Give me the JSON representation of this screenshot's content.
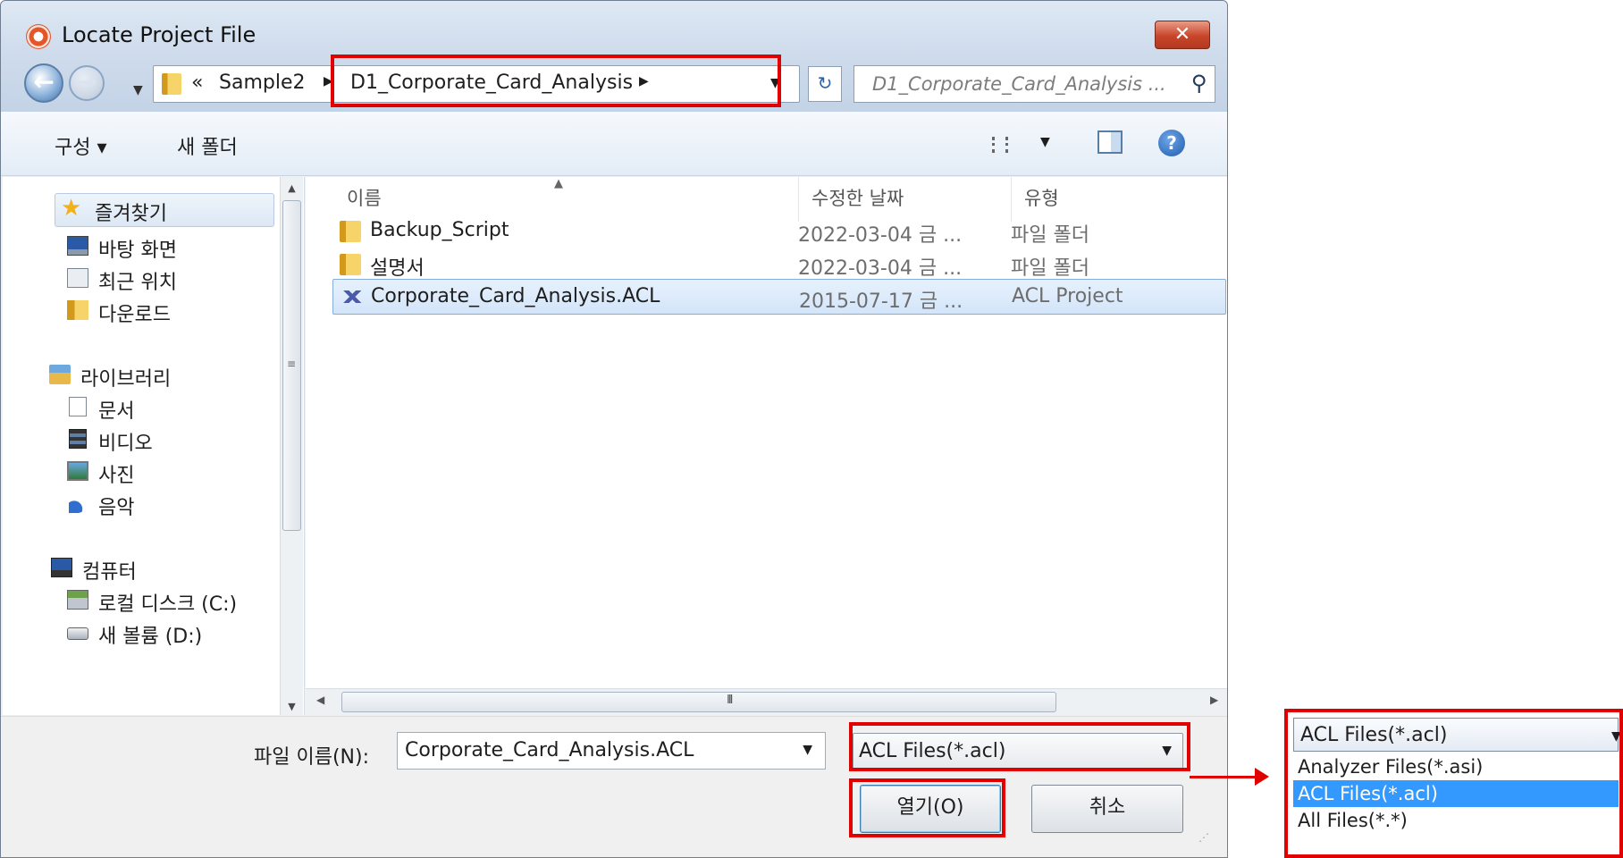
{
  "window": {
    "title": "Locate Project File",
    "close_label": "✕"
  },
  "nav": {
    "back_glyph": "←",
    "forward_glyph": "→"
  },
  "address_bar": {
    "overflow": "«",
    "crumbs": [
      "Sample2",
      "D1_Corporate_Card_Analysis"
    ]
  },
  "search": {
    "placeholder": "D1_Corporate_Card_Analysis ..."
  },
  "toolbar": {
    "organize": "구성 ▾",
    "new_folder": "새 폴더",
    "help": "?"
  },
  "sidebar": {
    "favorites": "즐겨찾기",
    "items": [
      {
        "label": "바탕 화면",
        "icon": "desktop-icon"
      },
      {
        "label": "최근 위치",
        "icon": "recent-places-icon"
      },
      {
        "label": "다운로드",
        "icon": "downloads-icon"
      }
    ],
    "libraries": "라이브러리",
    "library_items": [
      {
        "label": "문서",
        "icon": "documents-icon"
      },
      {
        "label": "비디오",
        "icon": "videos-icon"
      },
      {
        "label": "사진",
        "icon": "pictures-icon"
      },
      {
        "label": "음악",
        "icon": "music-icon"
      }
    ],
    "computer": "컴퓨터",
    "drives": [
      {
        "label": "로컬 디스크 (C:)",
        "icon": "local-disk-icon"
      },
      {
        "label": "새 볼륨 (D:)",
        "icon": "drive-icon"
      }
    ]
  },
  "file_list": {
    "columns": {
      "name": "이름",
      "modified": "수정한 날짜",
      "type": "유형"
    },
    "rows": [
      {
        "name": "Backup_Script",
        "modified": "2022-03-04 금 ...",
        "type": "파일 폴더",
        "selected": false
      },
      {
        "name": "설명서",
        "modified": "2022-03-04 금 ...",
        "type": "파일 폴더",
        "selected": false
      },
      {
        "name": "Corporate_Card_Analysis.ACL",
        "modified": "2015-07-17 금 ...",
        "type": "ACL Project",
        "selected": true
      }
    ],
    "hscroll_grip": "III"
  },
  "bottom": {
    "filename_label": "파일 이름(N):",
    "filename_value": "Corporate_Card_Analysis.ACL",
    "filetype_value": "ACL Files(*.acl)",
    "open_label": "열기(O)",
    "cancel_label": "취소"
  },
  "filetype_dropdown": {
    "selected": "ACL Files(*.acl)",
    "options": [
      "Analyzer Files(*.asi)",
      "ACL Files(*.acl)",
      "All Files(*.*)"
    ],
    "highlighted_index": 1
  },
  "colors": {
    "highlight_box": "#e00000",
    "selection": "#3399ff"
  }
}
